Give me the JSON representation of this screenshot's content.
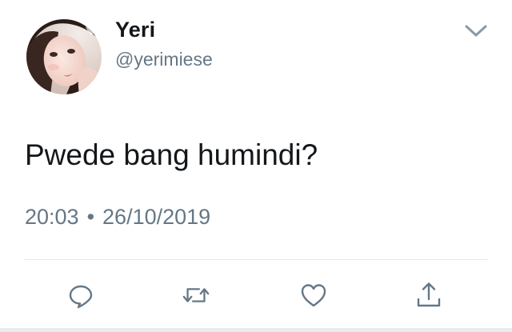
{
  "tweet": {
    "display_name": "Yeri",
    "handle": "@yerimiese",
    "text": "Pwede bang humindi?",
    "time": "20:03",
    "separator": "•",
    "date": "26/10/2019"
  },
  "icons": {
    "menu": "chevron-down-icon",
    "reply": "reply-icon",
    "retweet": "retweet-icon",
    "like": "heart-icon",
    "share": "share-icon"
  },
  "colors": {
    "text_primary": "#14171a",
    "text_secondary": "#657786",
    "icon": "#657786",
    "divider": "#e1e8ed"
  }
}
